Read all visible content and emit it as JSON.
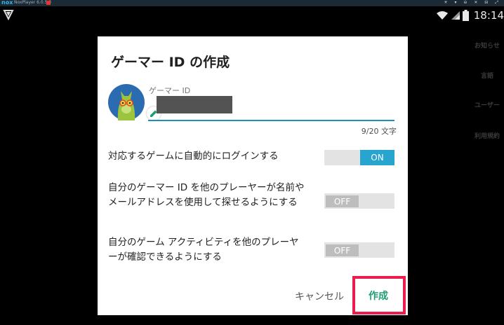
{
  "emulator": {
    "logo": "nox",
    "version": "NoxPlayer 6.0.5.3",
    "controls": "☀ ▾ ⊖ ✕ ⊟ ⤢"
  },
  "status_bar": {
    "left_icon": "play-games-icon",
    "icons": [
      "wifi-icon",
      "signal-icon",
      "battery-icon"
    ],
    "clock": "18:14"
  },
  "background_items": [
    "お知らせ",
    "言語",
    "ユーザー",
    "利用規約"
  ],
  "dialog": {
    "title": "ゲーマー ID の作成",
    "field_label": "ゲーマー ID",
    "field_value": "",
    "counter": "9/20 文字",
    "settings": [
      {
        "text": "対応するゲームに自動的にログインする",
        "state": "ON"
      },
      {
        "text": "自分のゲーマー ID を他のプレーヤーが名前やメールアドレスを使用して探せるようにする",
        "state": "OFF"
      },
      {
        "text": "自分のゲーム アクティビティを他のプレーヤーが確認できるようにする",
        "state": "OFF"
      }
    ],
    "cancel_label": "キャンセル",
    "create_label": "作成"
  },
  "colors": {
    "accent": "#27a5cf",
    "create": "#1e9e73",
    "highlight": "#ec1c4c"
  }
}
